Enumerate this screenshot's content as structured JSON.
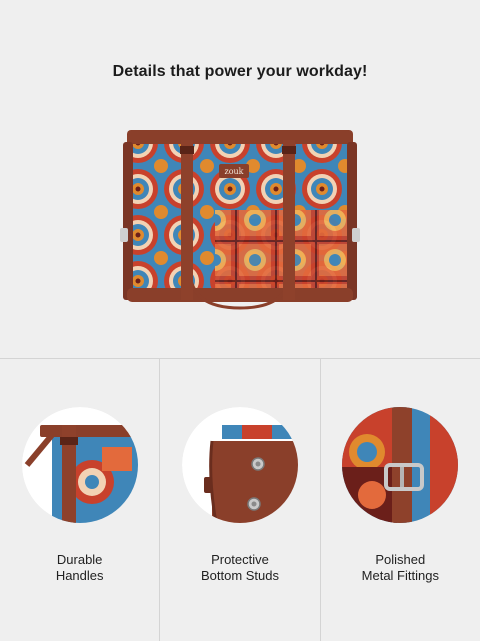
{
  "hero": {
    "headline": "Details that power your workday!",
    "brand_tag": "zouk"
  },
  "features": [
    {
      "line1": "Durable",
      "line2": "Handles"
    },
    {
      "line1": "Protective",
      "line2": "Bottom Studs"
    },
    {
      "line1": "Polished",
      "line2": "Metal Fittings"
    }
  ],
  "colors": {
    "background": "#efefef",
    "leather": "#8a3f2a",
    "pattern_blue": "#3f86b8",
    "pattern_red": "#c8412c",
    "pattern_orange": "#e08a2e"
  }
}
